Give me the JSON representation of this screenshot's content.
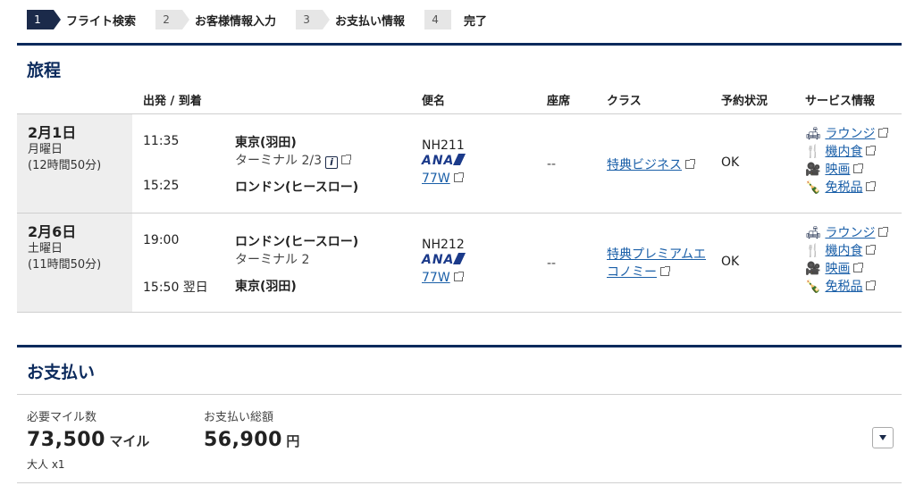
{
  "steps": [
    {
      "num": "1",
      "label": "フライト検索",
      "active": true
    },
    {
      "num": "2",
      "label": "お客様情報入力",
      "active": false
    },
    {
      "num": "3",
      "label": "お支払い情報",
      "active": false
    },
    {
      "num": "4",
      "label": "完了",
      "active": false
    }
  ],
  "itinerary": {
    "title": "旅程",
    "headers": {
      "dep_arr": "出発 / 到着",
      "flight": "便名",
      "seat": "座席",
      "class": "クラス",
      "status": "予約状況",
      "service": "サービス情報"
    },
    "rows": [
      {
        "date": "2月1日",
        "weekday": "月曜日",
        "duration": "(12時間50分)",
        "dep_time": "11:35",
        "dep_city": "東京(羽田)",
        "dep_terminal": "ターミナル 2/3",
        "arr_time": "15:25",
        "arr_city": "ロンドン(ヒースロー)",
        "flight_no": "NH211",
        "airline": "ANA",
        "aircraft": "77W",
        "seat": "--",
        "class_line1": "特典ビジネス",
        "class_line2": "",
        "status": "OK",
        "services": [
          "ラウンジ",
          "機内食",
          "映画",
          "免税品"
        ]
      },
      {
        "date": "2月6日",
        "weekday": "土曜日",
        "duration": "(11時間50分)",
        "dep_time": "19:00",
        "dep_city": "ロンドン(ヒースロー)",
        "dep_terminal": "ターミナル 2",
        "arr_time": "15:50 翌日",
        "arr_city": "東京(羽田)",
        "flight_no": "NH212",
        "airline": "ANA",
        "aircraft": "77W",
        "seat": "--",
        "class_line1": "特典プレミアムエ",
        "class_line2": "コノミー",
        "status": "OK",
        "services": [
          "ラウンジ",
          "機内食",
          "映画",
          "免税品"
        ]
      }
    ]
  },
  "payment": {
    "title": "お支払い",
    "miles_label": "必要マイル数",
    "miles_value": "73,500",
    "miles_unit": "マイル",
    "passengers": "大人 x1",
    "total_label": "お支払い総額",
    "total_value": "56,900",
    "total_unit": "円"
  },
  "colors": {
    "navy": "#0b2a5c",
    "link": "#1a5fa8"
  }
}
